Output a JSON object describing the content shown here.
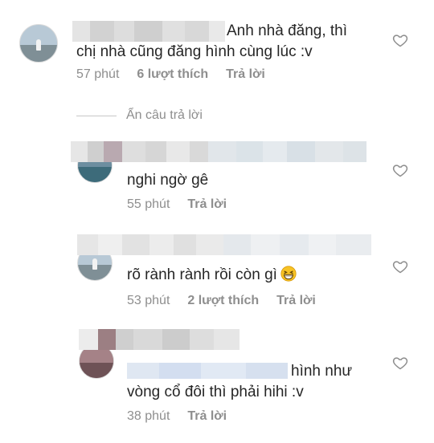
{
  "comments": [
    {
      "text_line1": "Anh nhà đăng, thì",
      "text_line2": "chị nhà cũng đăng hình cùng lúc :v",
      "time": "57 phút",
      "likes": "6 lượt thích",
      "reply": "Trả lời"
    },
    {
      "text_line1": "nghi ngờ gê",
      "time": "55 phút",
      "reply": "Trả lời"
    },
    {
      "text_line1": "rõ rành rành rồi còn gì",
      "time": "53 phút",
      "likes": "2 lượt thích",
      "reply": "Trả lời"
    },
    {
      "text_line1": "hình như",
      "text_line2": "vòng cổ đôi thì phải hihi :v",
      "time": "38 phút",
      "reply": "Trả lời"
    }
  ],
  "hide_replies": "Ẩn câu trả lời",
  "colors": {
    "text": "#262626",
    "meta": "#8e8e8e",
    "divider": "#c7c7c7",
    "heart": "#8e8e8e"
  },
  "icons": {
    "heart": "heart-outline-icon",
    "emoji": "grinning-squinting-face-icon"
  }
}
